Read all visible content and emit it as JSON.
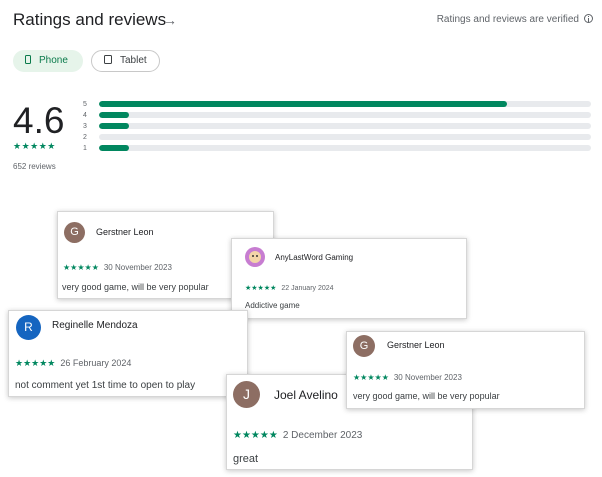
{
  "header": {
    "title": "Ratings and reviews",
    "arrow": "→",
    "verified_text": "Ratings and reviews are verified"
  },
  "device_chips": [
    {
      "label": "Phone",
      "selected": true
    },
    {
      "label": "Tablet",
      "selected": false
    }
  ],
  "summary": {
    "rating": "4.6",
    "stars": "★★★★★",
    "review_count": "652 reviews"
  },
  "histogram": [
    {
      "label": "5",
      "fraction": 0.83
    },
    {
      "label": "4",
      "fraction": 0.06
    },
    {
      "label": "3",
      "fraction": 0.06
    },
    {
      "label": "2",
      "fraction": 0.0
    },
    {
      "label": "1",
      "fraction": 0.06
    }
  ],
  "reviews": [
    {
      "avatar_letter": "G",
      "name": "Gerstner Leon",
      "stars": "★★★★★",
      "date": "30 November 2023",
      "text": "very good game, will be very popular"
    },
    {
      "avatar_letter": "",
      "name": "AnyLastWord Gaming",
      "stars": "★★★★★",
      "date": "22 January 2024",
      "text": "Addictive game"
    },
    {
      "avatar_letter": "R",
      "name": "Reginelle Mendoza",
      "stars": "★★★★★",
      "date": "26 February 2024",
      "text": "not comment yet 1st time to open to play"
    },
    {
      "avatar_letter": "G",
      "name": "Gerstner Leon",
      "stars": "★★★★★",
      "date": "30 November 2023",
      "text": "very good game, will be very popular"
    },
    {
      "avatar_letter": "J",
      "name": "Joel Avelino",
      "stars": "★★★★★",
      "date": "2 December 2023",
      "text": "great"
    }
  ],
  "colors": {
    "accent": "#01875f",
    "track": "#e8eaed",
    "chip_selected_bg": "#e6f4ea"
  },
  "icons": {
    "arrow": "arrow-right-icon",
    "verified": "info-icon",
    "phone": "phone-icon",
    "tablet": "tablet-icon"
  }
}
